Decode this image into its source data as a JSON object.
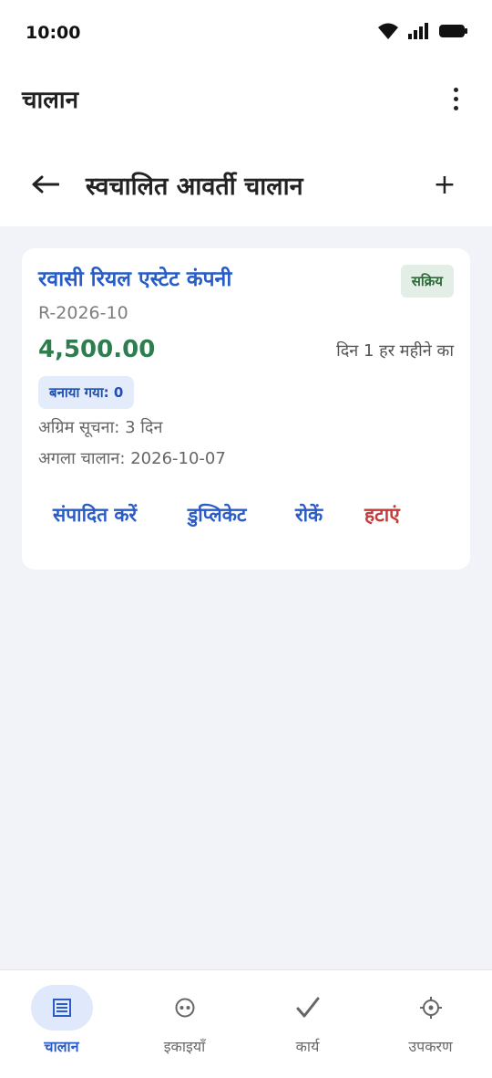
{
  "status_bar": {
    "time": "10:00"
  },
  "app_bar": {
    "title": "चालान"
  },
  "sub_header": {
    "title": "स्वचालित आवर्ती चालान",
    "add_label": "+"
  },
  "invoice": {
    "company": "रवासी रियल एस्टेट कंपनी",
    "status": "सक्रिय",
    "reference": "R-2026-10",
    "amount": "4,500.00",
    "schedule": "दिन 1 हर महीने का",
    "created": "बनाया गया: 0",
    "advance_notice": "अग्रिम सूचना: 3 दिन",
    "next_invoice": "अगला चालान: 2026-10-07",
    "actions": {
      "edit": "संपादित करें",
      "duplicate": "डुप्लिकेट",
      "pause": "रोकें",
      "remove": "हटाएं"
    }
  },
  "bottom_nav": [
    {
      "label": "चालान",
      "icon": "invoice-icon",
      "active": true
    },
    {
      "label": "इकाइयाँ",
      "icon": "units-icon",
      "active": false
    },
    {
      "label": "कार्य",
      "icon": "check-icon",
      "active": false
    },
    {
      "label": "उपकरण",
      "icon": "gear-icon",
      "active": false
    }
  ],
  "colors": {
    "accent": "#2a5cc7",
    "amount": "#2e7d4f",
    "danger": "#c53a3a",
    "background": "#f1f3f8"
  }
}
